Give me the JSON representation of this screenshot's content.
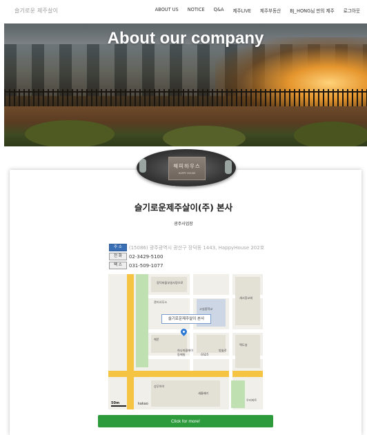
{
  "nav": {
    "brand": "슬기로운 제주살이",
    "items": [
      "ABOUT US",
      "NOTICE",
      "Q&A",
      "제주LIVE",
      "제주부동산",
      "BJ_HONG님 만의 제주",
      "로그아웃"
    ]
  },
  "hero": {
    "title": "About our company"
  },
  "logo": {
    "text": "해피하우스",
    "sub": "HAPPY HOUSE"
  },
  "company": {
    "name": "슬기로운제주살이(주) 본사",
    "subtitle": "광주사업장",
    "address_label": "주 소",
    "address": "(15086) 광주광역시 광산구 장덕동 1443, HappyHouse 202호",
    "phone_label": "전 화",
    "phone": "02-3429-5100",
    "fax_label": "팩 스",
    "fax": "031-509-1077"
  },
  "map": {
    "label": "슬기로운제주살이 본사",
    "scale": "50m",
    "provider": "kakao",
    "places": [
      "장덕마을부영사랑으로",
      "관리사무소",
      "고실중학교",
      "새시장교회",
      "해운",
      "하나마을메이",
      "동해빌",
      "GS25",
      "방솔로",
      "맥도날",
      "상무아이",
      "새롬배기",
      "우리마트"
    ]
  },
  "cta": {
    "label": "Click for more!"
  },
  "colors": {
    "cta": "#2d9a3c",
    "tag_blue": "#3a6fb5",
    "pin": "#2d79d8"
  }
}
